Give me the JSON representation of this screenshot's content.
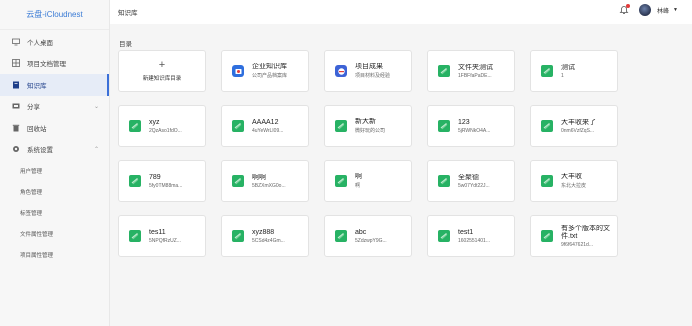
{
  "app": {
    "logo": "云盘-iCloudnest"
  },
  "sidebar": {
    "items": [
      {
        "label": "个人桌面",
        "icon": "monitor-icon"
      },
      {
        "label": "项目文档管理",
        "icon": "grid-icon"
      },
      {
        "label": "知识库",
        "icon": "book-icon",
        "active": true
      },
      {
        "label": "分享",
        "icon": "share-icon",
        "expandable": true
      },
      {
        "label": "回收站",
        "icon": "trash-icon"
      },
      {
        "label": "系统设置",
        "icon": "gear-icon",
        "expandable": true,
        "expanded": true
      }
    ],
    "sub_items": [
      "用户管理",
      "角色管理",
      "标签管理",
      "文件属性管理",
      "项目属性管理"
    ]
  },
  "header": {
    "breadcrumb": "知识库",
    "username": "林峰"
  },
  "main": {
    "section_title": "目录",
    "add_card_label": "新建知识库目录",
    "add_card_symbol": "+",
    "cards": [
      {
        "title": "企业知识库",
        "subtitle": "公司产品档案库",
        "icon": "company-icon",
        "color": "#2f6fde"
      },
      {
        "title": "项目成果",
        "subtitle": "项目材料及经验",
        "icon": "project-icon",
        "color": "#3d63d6"
      },
      {
        "title": "文件夹测试",
        "subtitle": "1FBFfaPaDE...",
        "icon": "folder-icon",
        "color": "#27b264"
      },
      {
        "title": "测试",
        "subtitle": "1",
        "icon": "folder-icon",
        "color": "#27b264"
      },
      {
        "title": "xyz",
        "subtitle": "2QzAso1fdO...",
        "icon": "folder-icon",
        "color": "#27b264"
      },
      {
        "title": "AAAA12",
        "subtitle": "4uYeWrLI09...",
        "icon": "folder-icon",
        "color": "#27b264"
      },
      {
        "title": "新大新",
        "subtitle": "微好玩的公司",
        "icon": "folder-icon",
        "color": "#27b264"
      },
      {
        "title": "123",
        "subtitle": "5jRWNkO4A...",
        "icon": "folder-icon",
        "color": "#27b264"
      },
      {
        "title": "大丰收来了",
        "subtitle": "0nm6VzfZqS...",
        "icon": "folder-icon",
        "color": "#27b264"
      },
      {
        "title": "789",
        "subtitle": "5fy0TM88ma...",
        "icon": "folder-icon",
        "color": "#27b264"
      },
      {
        "title": "啊啊",
        "subtitle": "5BZXmXG0o...",
        "icon": "folder-icon",
        "color": "#27b264"
      },
      {
        "title": "啊",
        "subtitle": "啊",
        "icon": "folder-icon",
        "color": "#27b264"
      },
      {
        "title": "全聚德",
        "subtitle": "5w07Ydt22J...",
        "icon": "folder-icon",
        "color": "#27b264"
      },
      {
        "title": "大丰收",
        "subtitle": "东北大拉皮",
        "icon": "folder-icon",
        "color": "#27b264"
      },
      {
        "title": "tes11",
        "subtitle": "5NPQfRzUZ...",
        "icon": "folder-icon",
        "color": "#27b264"
      },
      {
        "title": "xyz888",
        "subtitle": "5CSd4z4Gm...",
        "icon": "folder-icon",
        "color": "#27b264"
      },
      {
        "title": "abc",
        "subtitle": "5ZdzwpY9G...",
        "icon": "folder-icon",
        "color": "#27b264"
      },
      {
        "title": "test1",
        "subtitle": "1602551401...",
        "icon": "folder-icon",
        "color": "#27b264"
      },
      {
        "title": "有多个版本的文件.txt",
        "subtitle": "9f6f647621d...",
        "icon": "folder-icon",
        "color": "#27b264",
        "wrap": true
      }
    ]
  },
  "colors": {
    "accent": "#3a6fd8",
    "folder_green": "#27b264",
    "notify_red": "#e23b3b"
  }
}
